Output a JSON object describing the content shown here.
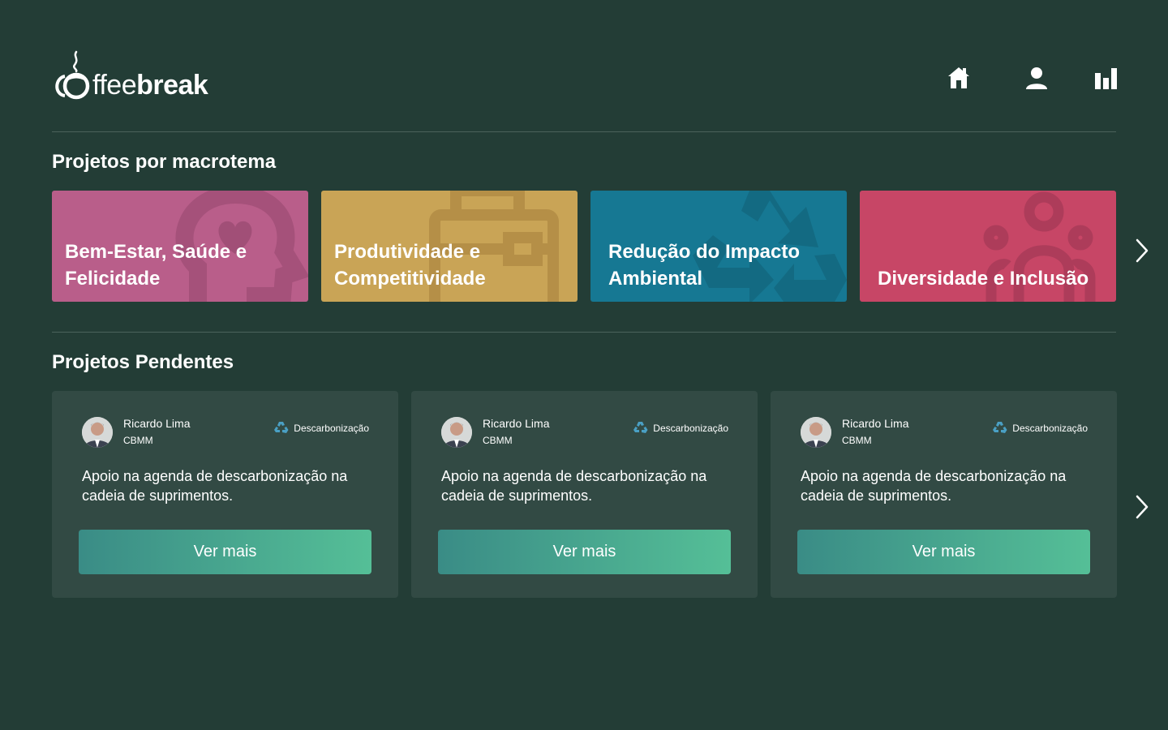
{
  "brand": {
    "logo_light": "ffee",
    "logo_bold": "break"
  },
  "nav": {
    "icons": [
      "home-icon",
      "user-icon",
      "bar-chart-icon"
    ]
  },
  "sections": {
    "themes_title": "Projetos por macrotema",
    "pending_title": "Projetos Pendentes"
  },
  "themes": [
    {
      "label": "Bem-Estar, Saúde e Felicidade",
      "color": "#b95e8a",
      "icon": "head-heart-icon"
    },
    {
      "label": "Produtividade e Competitividade",
      "color": "#c9a456",
      "icon": "briefcase-icon"
    },
    {
      "label": "Redução do Impacto Ambiental",
      "color": "#167893",
      "icon": "recycle-icon"
    },
    {
      "label": "Diversidade e Inclusão",
      "color": "#c74666",
      "icon": "people-icon"
    }
  ],
  "projects": [
    {
      "name": "Ricardo Lima",
      "org": "CBMM",
      "tag": "Descarbonização",
      "description": "Apoio na agenda de descarbonização na cadeia de suprimentos.",
      "button": "Ver mais"
    },
    {
      "name": "Ricardo Lima",
      "org": "CBMM",
      "tag": "Descarbonização",
      "description": "Apoio na agenda de descarbonização na cadeia de suprimentos.",
      "button": "Ver mais"
    },
    {
      "name": "Ricardo Lima",
      "org": "CBMM",
      "tag": "Descarbonização",
      "description": "Apoio na agenda de descarbonização na cadeia de suprimentos.",
      "button": "Ver mais"
    }
  ],
  "colors": {
    "background": "#233d36",
    "card": "#324a44",
    "button_start": "#3a8c86",
    "button_end": "#55bf97"
  }
}
